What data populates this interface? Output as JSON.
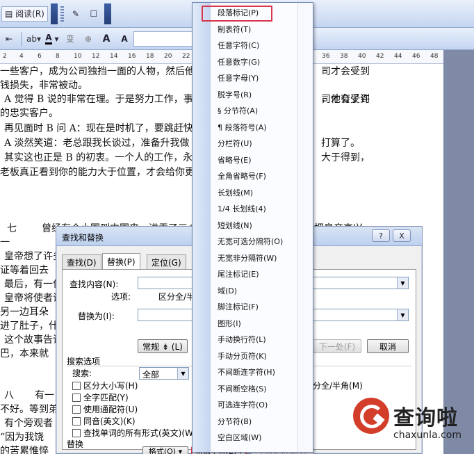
{
  "toolbar": {
    "reading_label": "阅读(R)",
    "format_buttons": [
      "A",
      "变",
      "A",
      "A"
    ]
  },
  "ruler": {
    "ticks": [
      "2",
      "4",
      "6",
      "8",
      "10",
      "12",
      "14",
      "16",
      "18",
      "20",
      "22",
      "24",
      "26",
      "36",
      "38",
      "40",
      "42",
      "44",
      "46",
      "48"
    ]
  },
  "document": {
    "lines": [
      "一些客户，成为公司独挡一面的人物，然后他",
      "钱损失，非常被动。",
      "A 觉得 B 说的非常在理。于是努力工作，事",
      "的忠实客户。",
      "再见面时 B 问 A：现在是时机了，要跳赶快",
      "A 淡然笑道：老总跟我长谈过，准备升我做",
      "其实这也正是 B 的初衷。一个人的工作，永",
      "老板真正看到你的能力大于位置，才会给你更",
      "七",
      "曾经有个小国到中国来，进贡了三个",
      "一",
      "皇帝想了许多",
      "证等着回去",
      "最后，有一位",
      "皇帝将使者请",
      "另一边耳朵",
      "进了肚子，什",
      "这个故事告诉",
      "巴，本来就",
      "八",
      "有一",
      "不好。等到弟子",
      "有个旁观者",
      "“因为我饶",
      "的苦累惟悴"
    ],
    "right_fragments": [
      "司才会受到",
      "，他有了许",
      "打算了。",
      "大于得到，",
      "把皇帝高兴"
    ]
  },
  "dialog": {
    "title": "查找和替换",
    "help": "?",
    "close": "X",
    "tabs": [
      "查找(D)",
      "替换(P)",
      "定位(G)"
    ],
    "find_label": "查找内容(N):",
    "options_label": "选项:",
    "options_value": "区分全/半角",
    "replace_label": "替换为(I):",
    "regular_button": "常规 ⇟ (L)",
    "find_next_button": "下一处(F)",
    "cancel_button": "取消",
    "search_options_title": "搜索选项",
    "search_label": "搜索:",
    "search_value": "全部",
    "checkboxes": [
      "区分大小写(H)",
      "全字匹配(Y)",
      "使用通配符(U)",
      "同音(英文)(K)",
      "查找单词的所有形式(英文)(W)"
    ],
    "right_checkbox": "区分全/半角(M)",
    "replace_section": "替换",
    "format_button": "格式(O) ▾",
    "special_button": "特殊字符(E) ▾",
    "no_format_button": "不限定格式(T)"
  },
  "menu": {
    "items": [
      "段落标记(P)",
      "制表符(T)",
      "任意字符(C)",
      "任意数字(G)",
      "任意字母(Y)",
      "脱字号(R)",
      "§ 分节符(A)",
      "¶ 段落符号(A)",
      "分栏符(U)",
      "省略号(E)",
      "全角省略号(F)",
      "长划线(M)",
      "1/4 长划线(4)",
      "短划线(N)",
      "无宽可选分隔符(O)",
      "无宽非分隔符(W)",
      "尾注标记(E)",
      "域(D)",
      "脚注标记(F)",
      "图形(I)",
      "手动换行符(L)",
      "手动分页符(K)",
      "不间断连字符(H)",
      "不间断空格(S)",
      "可选连字符(O)",
      "分节符(B)",
      "空白区域(W)"
    ]
  },
  "watermark": {
    "brand": "查询啦",
    "url": "chaxunla.com"
  }
}
